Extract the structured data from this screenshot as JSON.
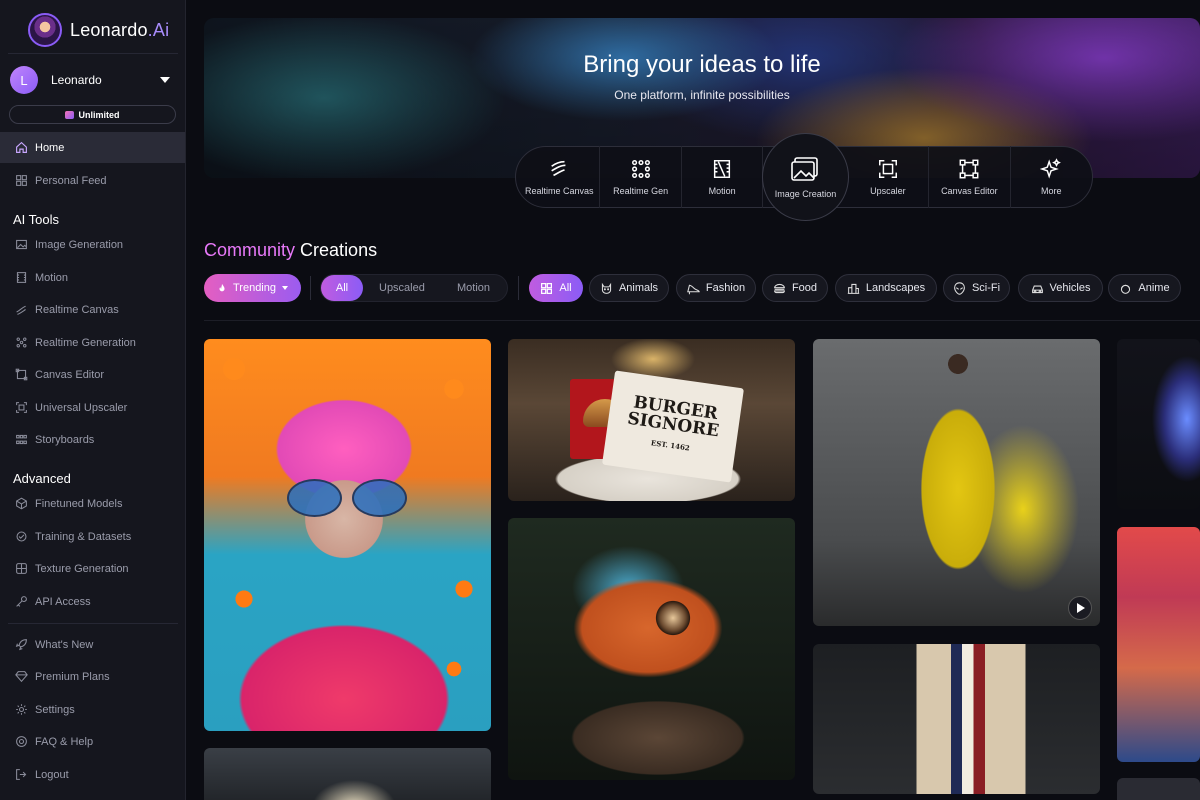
{
  "brand": {
    "name": "Leonardo",
    "suffix": ".Ai"
  },
  "user": {
    "initial": "L",
    "name": "Leonardo",
    "plan": "Unlimited"
  },
  "nav": {
    "home": "Home",
    "personal_feed": "Personal Feed",
    "ai_tools_heading": "AI Tools",
    "ai_tools": [
      "Image Generation",
      "Motion",
      "Realtime Canvas",
      "Realtime Generation",
      "Canvas Editor",
      "Universal Upscaler",
      "Storyboards"
    ],
    "advanced_heading": "Advanced",
    "advanced": [
      "Finetuned Models",
      "Training & Datasets",
      "Texture Generation",
      "API Access"
    ],
    "footer": [
      "What's New",
      "Premium Plans",
      "Settings",
      "FAQ & Help",
      "Logout"
    ]
  },
  "hero": {
    "title": "Bring your ideas to life",
    "subtitle": "One platform, infinite possibilities",
    "tools": [
      "Realtime Canvas",
      "Realtime Gen",
      "Motion",
      "Image Creation",
      "Upscaler",
      "Canvas Editor",
      "More"
    ]
  },
  "community": {
    "title_accent": "Community",
    "title_rest": "Creations",
    "sort": "Trending",
    "type_filters": [
      "All",
      "Upscaled",
      "Motion"
    ],
    "categories": [
      "All",
      "Animals",
      "Fashion",
      "Food",
      "Landscapes",
      "Sci-Fi",
      "Vehicles",
      "Anime"
    ]
  },
  "gallery": {
    "burger_brand_line1": "BURGER",
    "burger_brand_line2": "SIGNORE",
    "burger_est": "EST. 1462"
  },
  "colors": {
    "accent_pink": "#e45ec1",
    "accent_purple": "#8b5cf6",
    "sidebar_bg": "#15161e",
    "page_bg": "#0b0c12"
  },
  "icons": [
    "home-icon",
    "grid-icon",
    "image-icon",
    "film-icon",
    "brush-icon",
    "bolt-icon",
    "crop-icon",
    "upscale-icon",
    "storyboard-icon",
    "cube-icon",
    "dataset-icon",
    "texture-icon",
    "key-icon",
    "rocket-icon",
    "diamond-icon",
    "gear-icon",
    "help-icon",
    "logout-icon",
    "flame-icon",
    "play-icon",
    "sparkle-icon"
  ]
}
